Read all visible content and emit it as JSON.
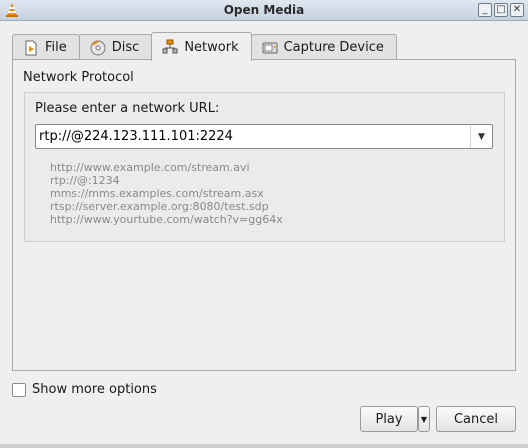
{
  "window": {
    "title": "Open Media"
  },
  "tabs": [
    {
      "label": "File",
      "icon": "file-icon"
    },
    {
      "label": "Disc",
      "icon": "disc-icon"
    },
    {
      "label": "Network",
      "icon": "network-icon",
      "active": true
    },
    {
      "label": "Capture Device",
      "icon": "capture-device-icon"
    }
  ],
  "network": {
    "group_title": "Network Protocol",
    "url_label": "Please enter a network URL:",
    "url_value": "rtp://@224.123.111.101:2224",
    "examples": [
      "http://www.example.com/stream.avi",
      "rtp://@:1234",
      "mms://mms.examples.com/stream.asx",
      "rtsp://server.example.org:8080/test.sdp",
      "http://www.yourtube.com/watch?v=gg64x"
    ]
  },
  "options": {
    "show_more_label": "Show more options",
    "show_more_checked": false
  },
  "buttons": {
    "play": "Play",
    "cancel": "Cancel"
  },
  "colors": {
    "accent_orange": "#f28c00"
  }
}
